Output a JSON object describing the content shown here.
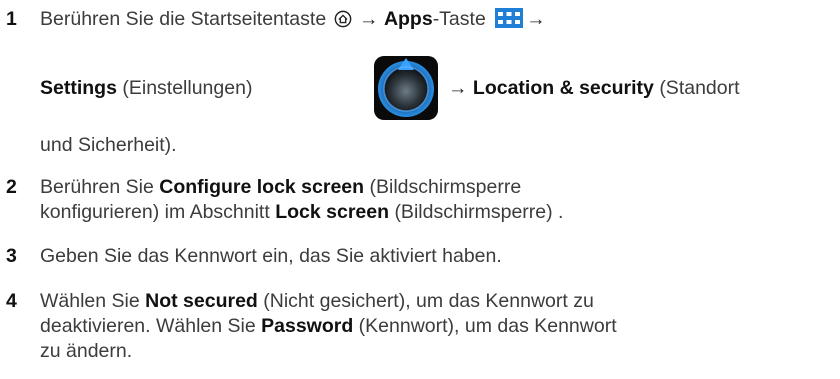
{
  "steps": [
    {
      "number": "1",
      "line1": {
        "pre": "Berühren Sie die Startseitentaste",
        "arrow1": "→",
        "apps_bold": "Apps",
        "apps_rest": "-Taste",
        "arrow2": "→"
      },
      "line2": {
        "settings_bold": "Settings",
        "settings_rest": "(Einstellungen)",
        "arrow": "→",
        "location_bold": "Location & security",
        "location_rest": "(Standort"
      },
      "line3": "und Sicherheit)."
    },
    {
      "number": "2",
      "line1": {
        "pre": "Berühren Sie",
        "bold": "Configure lock screen",
        "post": "(Bildschirmsperre"
      },
      "line2": {
        "pre": "konfigurieren) im Abschnitt",
        "bold": "Lock screen",
        "post": "(Bildschirmsperre) ."
      }
    },
    {
      "number": "3",
      "line1": "Geben Sie das Kennwort ein, das Sie aktiviert haben."
    },
    {
      "number": "4",
      "line1": {
        "pre": "Wählen Sie",
        "bold": "Not secured",
        "post": "(Nicht gesichert), um das Kennwort zu"
      },
      "line2": {
        "pre": "deaktivieren. Wählen Sie",
        "bold": "Password",
        "post": "(Kennwort), um das Kennwort"
      },
      "line3": "zu ändern."
    }
  ],
  "icons": {
    "home": "home-icon",
    "apps": "apps-grid-icon",
    "settings": "settings-icon"
  },
  "colors": {
    "text": "#3c3c3c",
    "apps_icon": "#1f7fd6",
    "settings_ring": "#2a8fe0"
  }
}
